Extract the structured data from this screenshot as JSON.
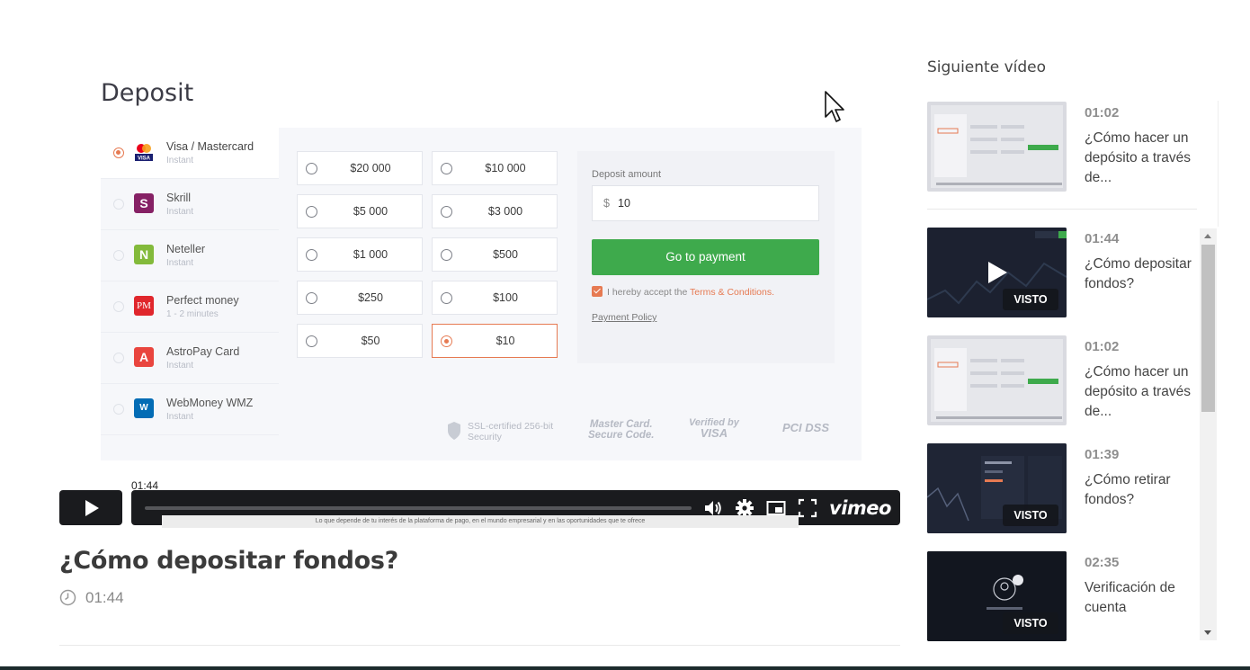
{
  "player": {
    "deposit_screen": {
      "title": "Deposit",
      "methods": [
        {
          "name": "Visa / Mastercard",
          "sub": "Instant",
          "logo": "visa-mastercard-icon",
          "selected": true
        },
        {
          "name": "Skrill",
          "sub": "Instant",
          "logo": "skrill-icon"
        },
        {
          "name": "Neteller",
          "sub": "Instant",
          "logo": "neteller-icon"
        },
        {
          "name": "Perfect money",
          "sub": "1 - 2 minutes",
          "logo": "perfect-money-icon"
        },
        {
          "name": "AstroPay Card",
          "sub": "Instant",
          "logo": "astropay-icon"
        },
        {
          "name": "WebMoney WMZ",
          "sub": "Instant",
          "logo": "webmoney-icon"
        }
      ],
      "amounts": [
        "$20 000",
        "$10 000",
        "$5 000",
        "$3 000",
        "$1 000",
        "$500",
        "$250",
        "$100",
        "$50",
        "$10"
      ],
      "selected_amount": "$10",
      "deposit_amount_label": "Deposit amount",
      "currency_symbol": "$",
      "deposit_amount_value": "10",
      "go_button": "Go to payment",
      "accept_text": "I hereby accept the",
      "terms_link": "Terms & Conditions.",
      "payment_policy": "Payment Policy",
      "trust": {
        "ssl": "SSL-certified 256-bit",
        "ssl_sub": "Security",
        "mastercard": "Master Card.",
        "mastercard_sub": "Secure Code.",
        "verified": "Verified by",
        "verified_sub": "VISA",
        "pci": "PCI DSS"
      },
      "accent_color": "#e67a52",
      "button_color": "#3eaa4c"
    },
    "time_tooltip": "01:44",
    "progress": 0,
    "logo": "vimeo",
    "controls": [
      "volume-icon",
      "settings-gear-icon",
      "picture-in-picture-icon",
      "fullscreen-icon"
    ],
    "subtitle_text": "Lo que depende de tu interés de la plataforma de pago, en el mundo empresarial y en las oportunidades que te ofrece"
  },
  "video": {
    "title": "¿Cómo depositar fondos?",
    "duration": "01:44"
  },
  "sidebar": {
    "title": "Siguiente vídeo",
    "items": [
      {
        "duration": "01:02",
        "title": "¿Cómo hacer un depósito a través de...",
        "watched": false,
        "thumb": "light"
      },
      {
        "duration": "01:44",
        "title": "¿Cómo depositar fondos?",
        "watched": true,
        "badge": "VISTO",
        "thumb": "dark"
      },
      {
        "duration": "01:02",
        "title": "¿Cómo hacer un depósito a través de...",
        "watched": false,
        "thumb": "light"
      },
      {
        "duration": "01:39",
        "title": "¿Cómo retirar fondos?",
        "watched": true,
        "badge": "VISTO",
        "thumb": "dark"
      },
      {
        "duration": "02:35",
        "title": "Verificación de cuenta",
        "watched": true,
        "badge": "VISTO",
        "thumb": "darker"
      }
    ]
  }
}
